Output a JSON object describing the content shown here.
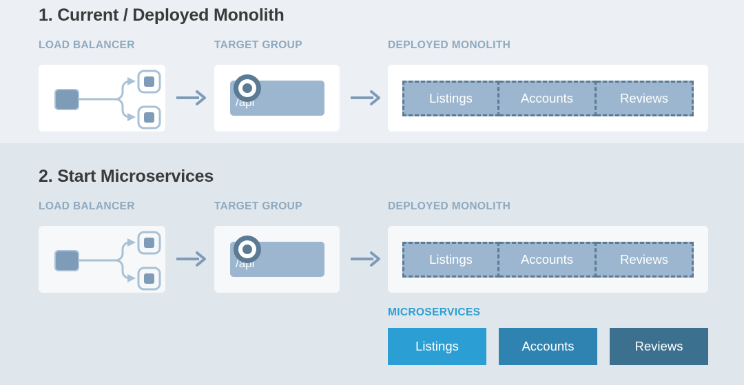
{
  "steps": [
    {
      "title": "1. Current / Deployed Monolith",
      "labels": {
        "load_balancer": "LOAD BALANCER",
        "target_group": "TARGET GROUP",
        "deployed_monolith": "DEPLOYED MONOLITH"
      },
      "target_group_path": "/api",
      "monolith_segments": [
        "Listings",
        "Accounts",
        "Reviews"
      ]
    },
    {
      "title": "2. Start Microservices",
      "labels": {
        "load_balancer": "LOAD BALANCER",
        "target_group": "TARGET GROUP",
        "deployed_monolith": "DEPLOYED MONOLITH",
        "microservices": "MICROSERVICES"
      },
      "target_group_path": "/api",
      "monolith_segments": [
        "Listings",
        "Accounts",
        "Reviews"
      ],
      "microservices": [
        {
          "label": "Listings",
          "color": "#2b9fd4"
        },
        {
          "label": "Accounts",
          "color": "#2e83b0"
        },
        {
          "label": "Reviews",
          "color": "#3c708f"
        }
      ]
    }
  ],
  "colors": {
    "panel_1_background": "#eceff3",
    "panel_2_background": "#dfe6ec",
    "card_background": "#ffffff",
    "card_background_tinted": "#f6f8fa",
    "label_muted": "#8fa9bf",
    "label_accent": "#2b9fd4",
    "title": "#3a3a3a",
    "icon_blue": "#7e9cb8",
    "icon_blue_light": "#a8c1d6",
    "monolith_fill": "#9bb6ce",
    "monolith_dash": "#5b7a94",
    "arrow": "#7e9cb8"
  },
  "icons": {
    "load_balancer": "load-balancer-icon",
    "target": "target-bullseye-icon",
    "arrow": "arrow-right-icon"
  }
}
